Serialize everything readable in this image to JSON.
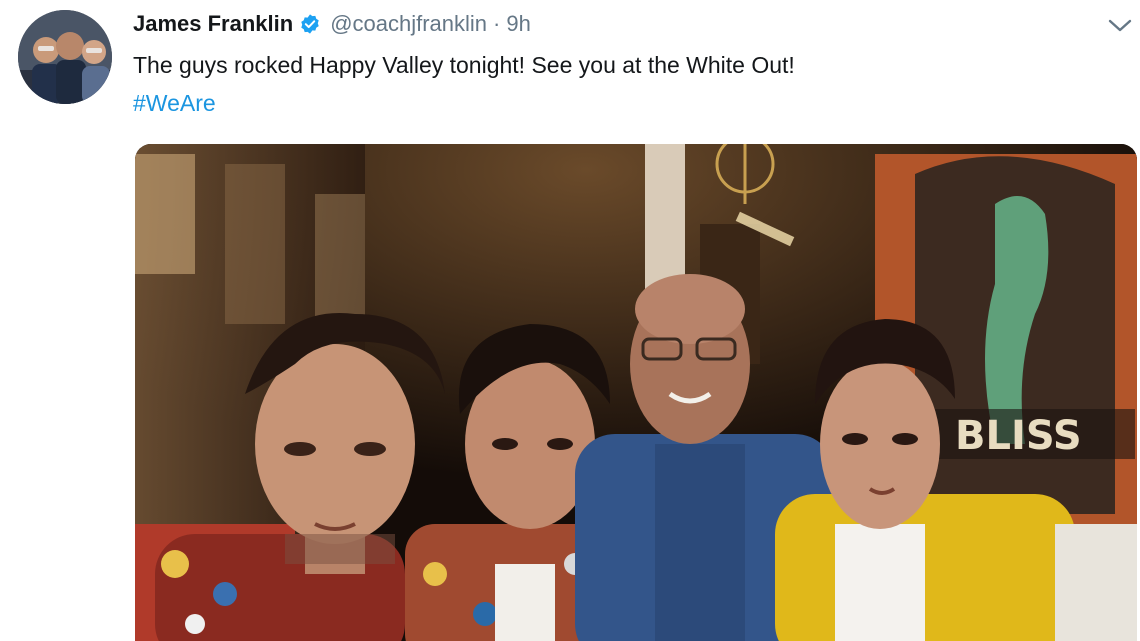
{
  "tweet": {
    "author_name": "James Franklin",
    "handle": "@coachjfranklin",
    "separator": "·",
    "time": "9h",
    "text": "The guys rocked Happy Valley tonight! See you at the White Out!",
    "hashtag": "#WeAre",
    "icons": {
      "verified": "verified-badge-icon",
      "caret": "chevron-down-icon"
    },
    "colors": {
      "link": "#1b95e0",
      "verified": "#1da1f2",
      "secondary_text": "#657786",
      "primary_text": "#14171a"
    }
  },
  "media": {
    "sign_text": "BLISS"
  }
}
